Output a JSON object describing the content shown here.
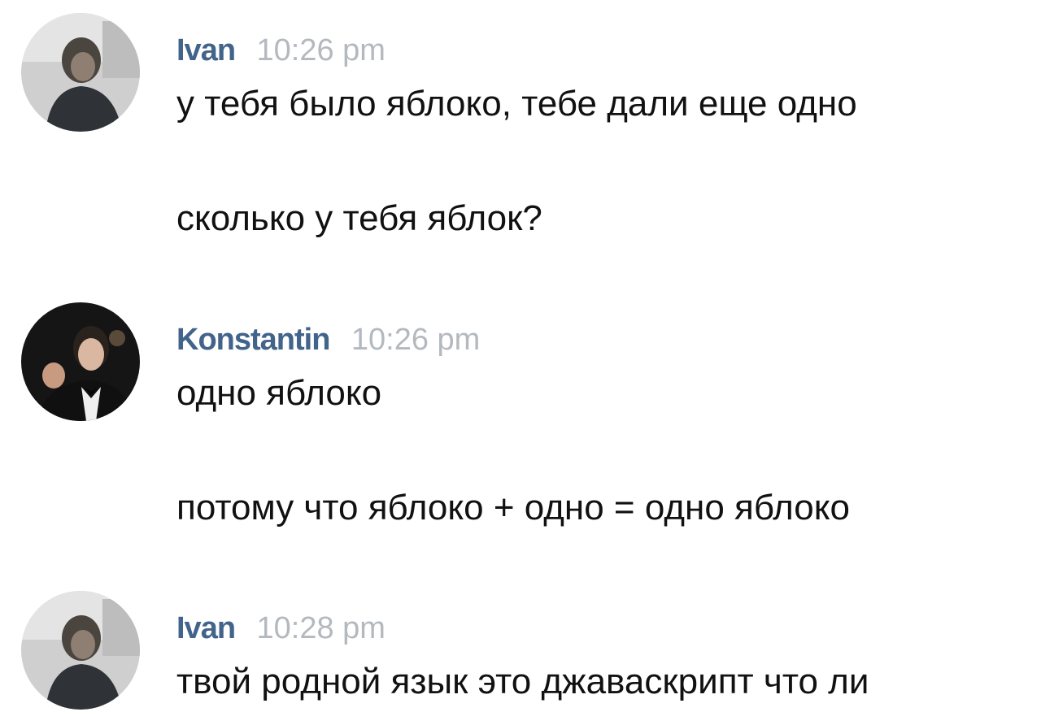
{
  "messages": [
    {
      "author": "Ivan",
      "time": "10:26 pm",
      "avatar": "avatar-ivan",
      "lines": [
        "у тебя было яблоко, тебе дали еще одно",
        "сколько у тебя яблок?"
      ]
    },
    {
      "author": "Konstantin",
      "time": "10:26 pm",
      "avatar": "avatar-konstantin",
      "lines": [
        "одно яблоко",
        "потому что яблоко + одно = одно яблоко"
      ]
    },
    {
      "author": "Ivan",
      "time": "10:28 pm",
      "avatar": "avatar-ivan",
      "lines": [
        "твой родной язык это джаваскрипт что ли"
      ]
    }
  ],
  "colors": {
    "author_link": "#42648b",
    "timestamp": "#b4b9bf",
    "message_text": "#111111",
    "background": "#ffffff"
  }
}
